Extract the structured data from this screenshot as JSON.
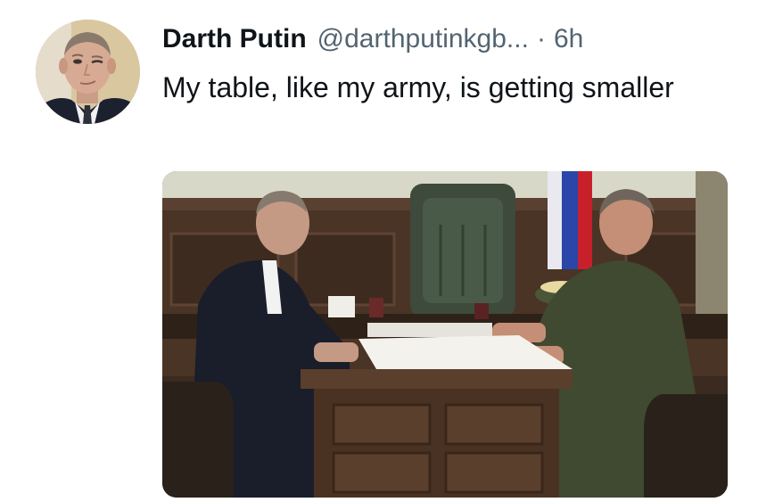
{
  "tweet": {
    "display_name": "Darth Putin",
    "handle": "@darthputinkgb...",
    "separator": "·",
    "time": "6h",
    "text": "My table, like my army, is getting smaller",
    "avatar": {
      "icon": "profile-photo-icon",
      "alt": "Profile photo of a man in a dark suit winking"
    },
    "media": {
      "icon": "attached-photo-icon",
      "alt": "Photo of two men seated at a small wooden desk in an office, one in a dark suit and one in a green military uniform"
    }
  },
  "colors": {
    "text_primary": "#0f1419",
    "text_secondary": "#536471",
    "background": "#ffffff"
  }
}
